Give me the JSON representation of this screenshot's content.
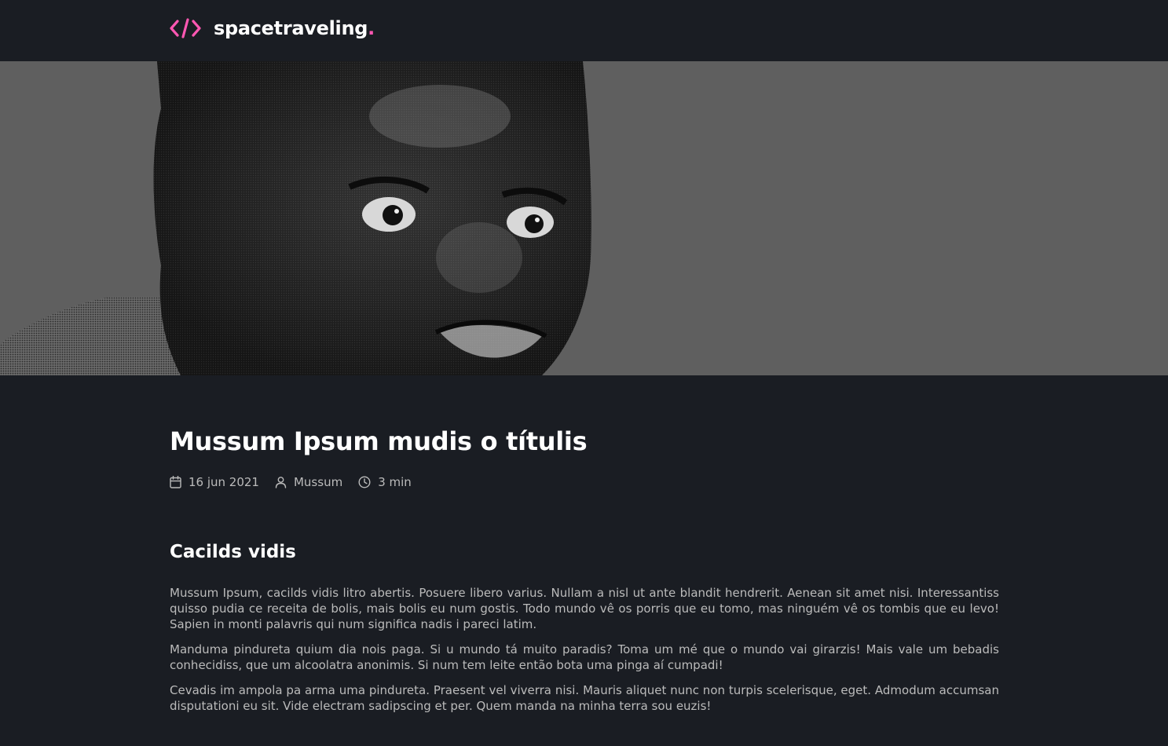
{
  "header": {
    "logo_icon": "code-brackets-icon",
    "brand_name": "spacetraveling",
    "brand_dot": ".",
    "accent_color": "#ff57b2"
  },
  "banner": {
    "image": "halftone-portrait-photo",
    "background_color": "#5f5f5f"
  },
  "post": {
    "title": "Mussum Ipsum mudis o títulis",
    "meta": {
      "date": "16 jun 2021",
      "author": "Mussum",
      "reading_time": "3 min",
      "date_icon": "calendar-icon",
      "author_icon": "user-icon",
      "time_icon": "clock-icon"
    },
    "sections": [
      {
        "heading": "Cacilds vidis",
        "paragraphs": [
          "Mussum Ipsum, cacilds vidis litro abertis. Posuere libero varius. Nullam a nisl ut ante blandit hendrerit. Aenean sit amet nisi. Interessantiss quisso pudia ce receita de bolis, mais bolis eu num gostis. Todo mundo vê os porris que eu tomo, mas ninguém vê os tombis que eu levo! Sapien in monti palavris qui num significa nadis i pareci latim.",
          "Manduma pindureta quium dia nois paga. Si u mundo tá muito paradis? Toma um mé que o mundo vai girarzis! Mais vale um bebadis conhecidiss, que um alcoolatra anonimis. Si num tem leite então bota uma pinga aí cumpadi!",
          "Cevadis im ampola pa arma uma pindureta. Praesent vel viverra nisi. Mauris aliquet nunc non turpis scelerisque, eget. Admodum accumsan disputationi eu sit. Vide electram sadipscing et per. Quem manda na minha terra sou euzis!"
        ]
      }
    ]
  }
}
